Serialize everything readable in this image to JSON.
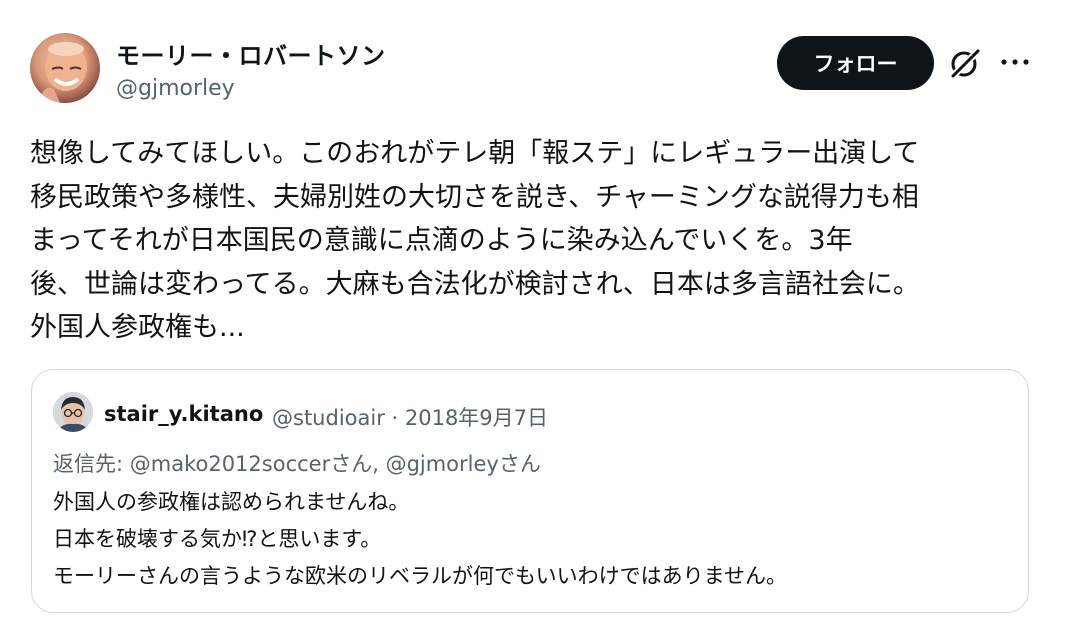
{
  "post": {
    "author_name": "モーリー・ロバートソン",
    "author_handle": "@gjmorley",
    "follow_label": "フォロー",
    "grok_icon": "grok-slash-circle-icon",
    "more_icon": "more-dots-icon",
    "text_lines": [
      "想像してみてほしい。このおれがテレ朝「報ステ」にレギュラー出演して",
      "移民政策や多様性、夫婦別姓の大切さを説き、チャーミングな説得力も相",
      "まってそれが日本国民の意識に点滴のように染み込んでいくを。3年",
      "後、世論は変わってる。大麻も合法化が検討され、日本は多言語社会に。",
      "外国人参政権も..."
    ]
  },
  "quote": {
    "author_name": "stair_y.kitano",
    "author_meta": "@studioair · 2018年9月7日",
    "reply_to": "返信先: @mako2012soccerさん, @gjmorleyさん",
    "text_lines": [
      "外国人の参政権は認められませんね。",
      "日本を破壊する気か⁉と思います。",
      "モーリーさんの言うような欧米のリベラルが何でもいいわけではありません。"
    ]
  }
}
